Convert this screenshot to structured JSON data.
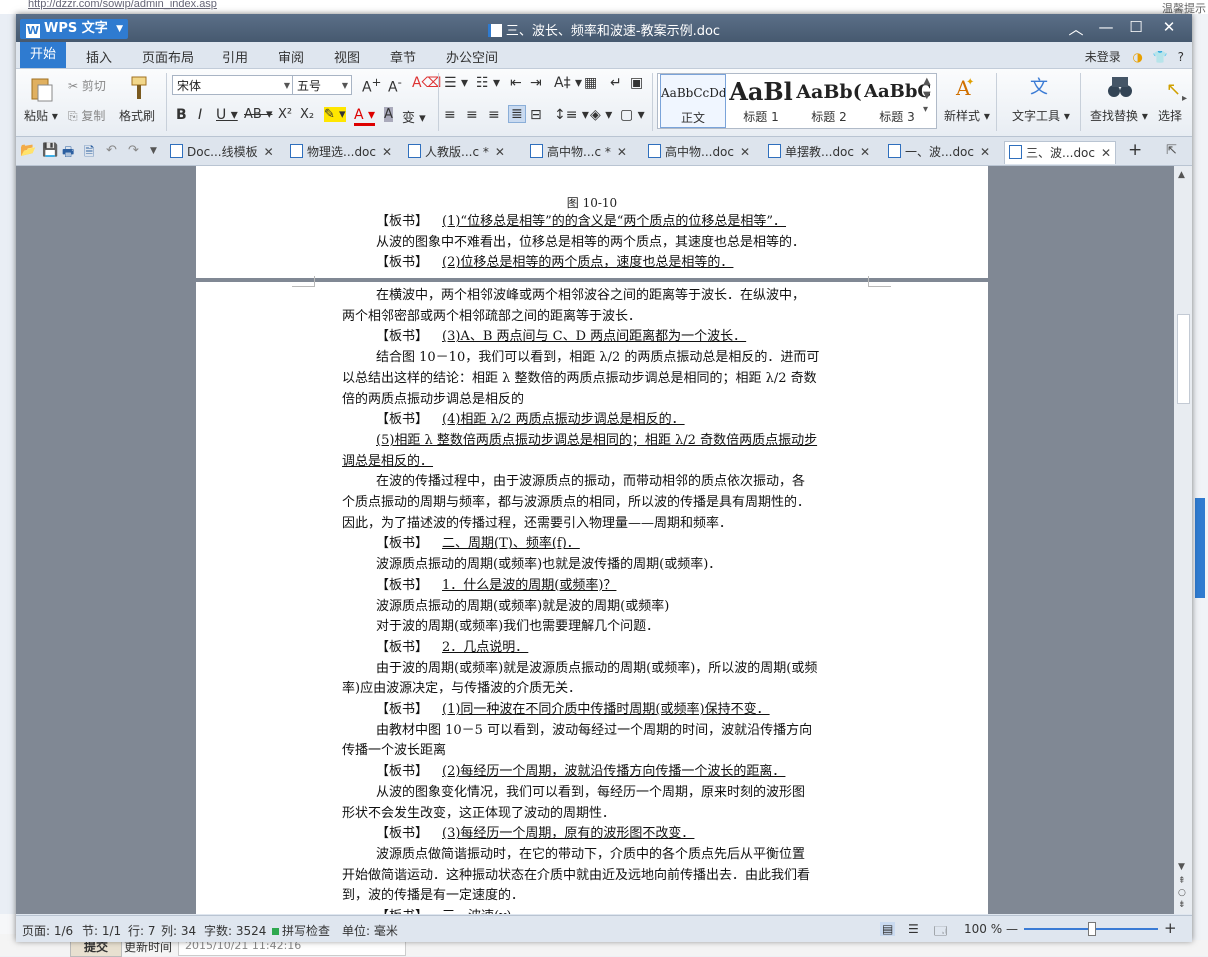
{
  "browser": {
    "url": "http://dzzr.com/sowip/admin_index.asp",
    "right_text": "温馨提示",
    "submit_label": "提交",
    "update_label": "更新时间",
    "update_value": "2015/10/21 11:42:16"
  },
  "window": {
    "app_name": "WPS 文字",
    "title": "三、波长、频率和波速-教案示例.doc"
  },
  "menu": {
    "items": [
      "开始",
      "插入",
      "页面布局",
      "引用",
      "审阅",
      "视图",
      "章节",
      "办公空间"
    ],
    "login": "未登录",
    "help": "?"
  },
  "ribbon": {
    "paste": "粘贴",
    "cut": "剪切",
    "copy": "复制",
    "format_painter": "格式刷",
    "font_name": "宋体",
    "font_size": "五号",
    "styles": [
      {
        "preview": "AaBbCcDd",
        "name": "正文"
      },
      {
        "preview": "AaBl",
        "name": "标题 1"
      },
      {
        "preview": "AaBb(",
        "name": "标题 2"
      },
      {
        "preview": "AaBbC",
        "name": "标题 3"
      }
    ],
    "new_style": "新样式",
    "text_tools": "文字工具",
    "find_replace": "查找替换",
    "select": "选择"
  },
  "tabs": [
    "Doc...线模板",
    "物理选...doc",
    "人教版...c *",
    "高中物...c *",
    "高中物...doc",
    "单摆教...doc",
    "一、波...doc",
    "三、波...doc"
  ],
  "document": {
    "fig_caption": "图 10-10",
    "page1": [
      {
        "label": "【板书】",
        "text": "(1)“位移总是相等”的的含义是“两个质点的位移总是相等”．"
      },
      {
        "text": "从波的图象中不难看出，位移总是相等的两个质点，其速度也总是相等的．",
        "indent": true
      },
      {
        "label": "【板书】",
        "text": "(2)位移总是相等的两个质点，速度也总是相等的．"
      }
    ],
    "page2": [
      {
        "text": "在横波中，两个相邻波峰或两个相邻波谷之间的距离等于波长．在纵波中，",
        "indent": true
      },
      {
        "text": "两个相邻密部或两个相邻疏部之间的距离等于波长．"
      },
      {
        "label": "【板书】",
        "text": "(3)A、B 两点间与 C、D 两点间距离都为一个波长．"
      },
      {
        "text": "结合图 10－10，我们可以看到，相距 λ/2 的两质点振动总是相反的．进而可",
        "indent": true
      },
      {
        "text": "以总结出这样的结论：相距 λ 整数倍的两质点振动步调总是相同的；相距 λ/2 奇数"
      },
      {
        "text": "倍的两质点振动步调总是相反的"
      },
      {
        "label": "【板书】",
        "text": "(4)相距 λ/2 两质点振动步调总是相反的．"
      },
      {
        "text": "(5)相距 λ 整数倍两质点振动步调总是相同的；相距 λ/2 奇数倍两质点振动步",
        "indent": true,
        "under": true
      },
      {
        "text": "调总是相反的．",
        "under": true
      },
      {
        "text": "在波的传播过程中，由于波源质点的振动，而带动相邻的质点依次振动，各",
        "indent": true
      },
      {
        "text": "个质点振动的周期与频率，都与波源质点的相同，所以波的传播是具有周期性的．"
      },
      {
        "text": "因此，为了描述波的传播过程，还需要引入物理量——周期和频率．"
      },
      {
        "label": "【板书】",
        "text": "二、周期(T)、频率(f)．"
      },
      {
        "text": "波源质点振动的周期(或频率)也就是波传播的周期(或频率)．",
        "indent": true
      },
      {
        "label": "【板书】",
        "text": "1．什么是波的周期(或频率)？"
      },
      {
        "text": "波源质点振动的周期(或频率)就是波的周期(或频率)",
        "indent": true
      },
      {
        "text": "对于波的周期(或频率)我们也需要理解几个问题．",
        "indent": true
      },
      {
        "label": "【板书】",
        "text": "2．几点说明．"
      },
      {
        "text": "由于波的周期(或频率)就是波源质点振动的周期(或频率)，所以波的周期(或频",
        "indent": true
      },
      {
        "text": "率)应由波源决定，与传播波的介质无关．"
      },
      {
        "label": "【板书】",
        "text": "(1)同一种波在不同介质中传播时周期(或频率)保持不变．"
      },
      {
        "text": "由教材中图 10－5 可以看到，波动每经过一个周期的时间，波就沿传播方向",
        "indent": true
      },
      {
        "text": "传播一个波长距离"
      },
      {
        "label": "【板书】",
        "text": "(2)每经历一个周期，波就沿传播方向传播一个波长的距离．"
      },
      {
        "text": "从波的图象变化情况，我们可以看到，每经历一个周期，原来时刻的波形图",
        "indent": true
      },
      {
        "text": "形状不会发生改变，这正体现了波动的周期性．"
      },
      {
        "label": "【板书】",
        "text": "(3)每经历一个周期，原有的波形图不改变．"
      },
      {
        "text": "波源质点做简谐振动时，在它的带动下，介质中的各个质点先后从平衡位置",
        "indent": true
      },
      {
        "text": "开始做简谐运动．这种振动状态在介质中就由近及远地向前传播出去．由此我们看"
      },
      {
        "text": "到，波的传播是有一定速度的．"
      },
      {
        "label": "【板书】",
        "text": "三、波速(v)"
      }
    ]
  },
  "status": {
    "page": "页面: 1/6",
    "section": "节: 1/1",
    "row": "行: 7",
    "col": "列: 34",
    "words": "字数: 3524",
    "spell": "拼写检查",
    "unit": "单位: 毫米",
    "zoom": "100 %"
  }
}
